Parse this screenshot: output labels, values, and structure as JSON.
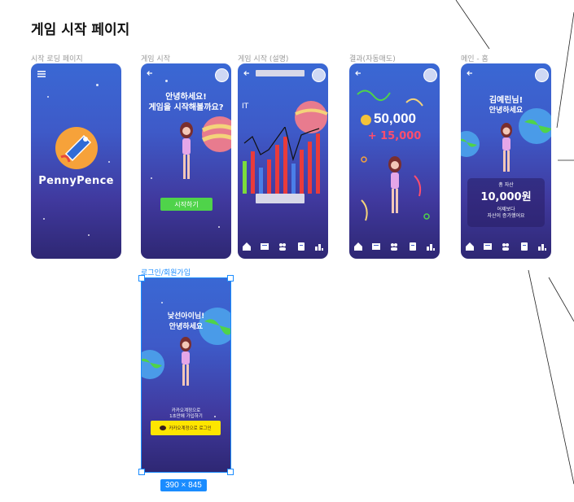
{
  "page": {
    "title": "게임 시작 페이지"
  },
  "frames": {
    "loading": {
      "label": "시작 로딩 페이지",
      "logo_text": "PennyPence"
    },
    "start": {
      "label": "게임 시작",
      "greeting_line1": "안녕하세요!",
      "greeting_line2": "게임을 시작해볼까요?",
      "start_button": "시작하기"
    },
    "tutorial": {
      "label": "게임 시작 (설명)",
      "ticker": "IT"
    },
    "result": {
      "label": "결과(자동매도)",
      "amount": "50,000",
      "gain": "+ 15,000"
    },
    "home": {
      "label": "메인 - 홈",
      "greeting_line1": "김예린님!",
      "greeting_line2": "안녕하세요",
      "asset_label": "총 자산",
      "asset_value": "10,000원",
      "asset_note_line1": "어제보다",
      "asset_note_line2": "자산이 증가했어요"
    },
    "login": {
      "label": "로그인/회원가입",
      "greeting_line1": "낯선아이님!",
      "greeting_line2": "안녕하세요",
      "signup_line1": "카카오계정으로",
      "signup_line2": "1초만에 가입하기",
      "kakao_button": "카카오계정으로 로그인"
    }
  },
  "selection": {
    "size_badge": "390 × 845"
  },
  "colors": {
    "accent": "#1a8cff",
    "kakao": "#fee500",
    "start_button": "#4fd34a",
    "gain": "#ff4d6d"
  },
  "icons": [
    "menu-icon",
    "back-arrow-icon",
    "home-tab-icon",
    "news-tab-icon",
    "community-tab-icon",
    "quest-tab-icon",
    "ranking-tab-icon",
    "kakao-chat-icon",
    "coin-icon"
  ]
}
